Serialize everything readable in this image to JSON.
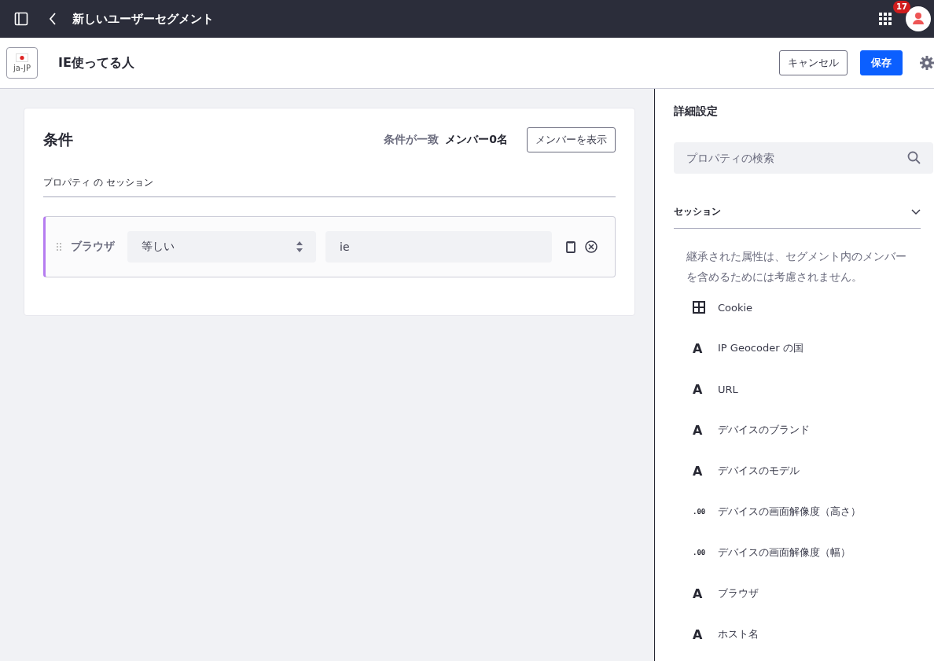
{
  "header": {
    "title": "新しいユーザーセグメント",
    "notification_count": "17"
  },
  "toolbar": {
    "locale": "ja-JP",
    "segment_name": "IE使ってる人",
    "buttons": [
      {
        "label": "キャンセル",
        "kind": "secondary"
      },
      {
        "label": "保存",
        "kind": "primary"
      }
    ]
  },
  "conditions": {
    "title": "条件",
    "match_label": "条件が一致",
    "member_count": "メンバー0名",
    "show_members_button": "メンバーを表示",
    "group_label": "プロパティ の セッション",
    "rows": [
      {
        "property": "ブラウザ",
        "operator": "等しい",
        "value": "ie"
      }
    ]
  },
  "sidebar": {
    "title": "詳細設定",
    "search": {
      "placeholder": "プロパティの検索"
    },
    "section": {
      "label": "セッション",
      "expanded": true,
      "note": "継承された属性は、セグメント内のメンバーを含めるためには考慮されません。",
      "items": [
        {
          "kind": "object",
          "label": "Cookie"
        },
        {
          "kind": "string",
          "glyph": "A",
          "label": "IP Geocoder の国"
        },
        {
          "kind": "string",
          "glyph": "A",
          "label": "URL"
        },
        {
          "kind": "string",
          "glyph": "A",
          "label": "デバイスのブランド"
        },
        {
          "kind": "string",
          "glyph": "A",
          "label": "デバイスのモデル"
        },
        {
          "kind": "number",
          "glyph": ".00",
          "label": "デバイスの画面解像度（高さ）"
        },
        {
          "kind": "number",
          "glyph": ".00",
          "label": "デバイスの画面解像度（幅）"
        },
        {
          "kind": "string",
          "glyph": "A",
          "label": "ブラウザ"
        },
        {
          "kind": "string",
          "glyph": "A",
          "label": "ホスト名"
        }
      ]
    }
  }
}
